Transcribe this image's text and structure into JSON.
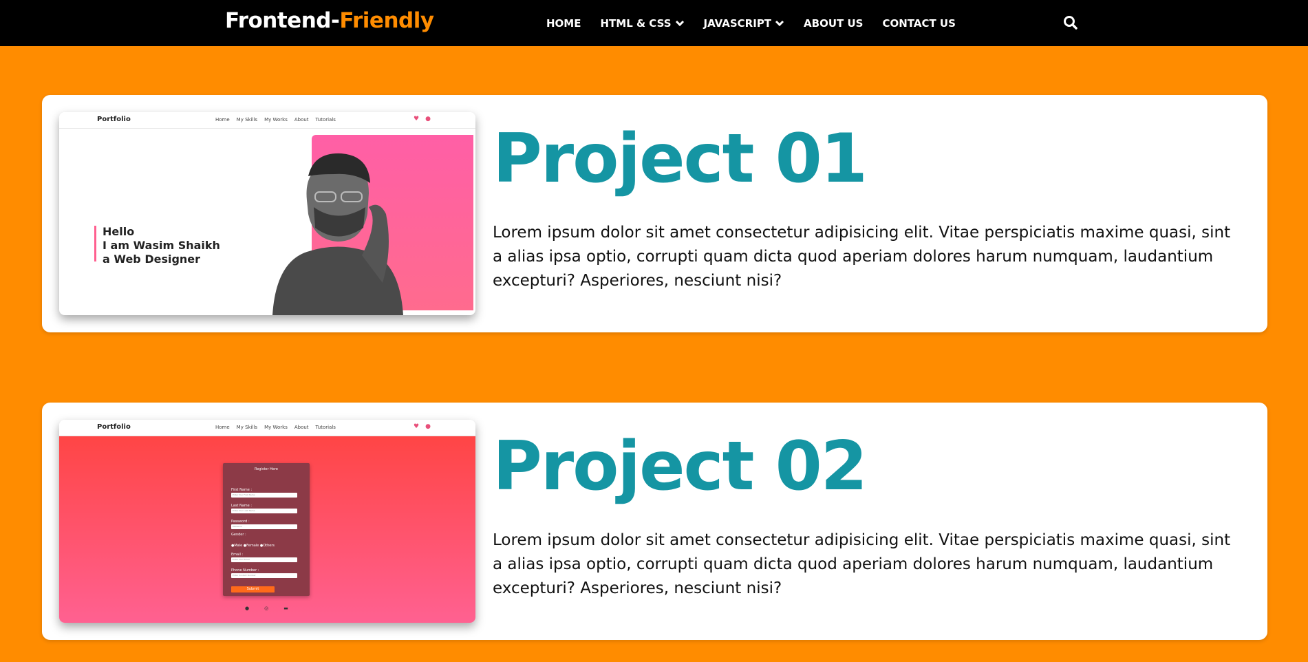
{
  "nav": {
    "brand_main": "Frontend-",
    "brand_accent": "Friendly",
    "items": [
      {
        "label": "HOME",
        "dropdown": false
      },
      {
        "label": "HTML & CSS",
        "dropdown": true
      },
      {
        "label": "JAVASCRIPT",
        "dropdown": true
      },
      {
        "label": "ABOUT US",
        "dropdown": false
      },
      {
        "label": "CONTACT US",
        "dropdown": false
      }
    ],
    "search_icon": "search-icon"
  },
  "colors": {
    "page_bg": "#ff8c00",
    "nav_bg": "#000000",
    "brand_accent": "#ff8c00",
    "title": "#1595a3"
  },
  "projects": [
    {
      "title": "Project 01",
      "description": "Lorem ipsum dolor sit amet consectetur adipisicing elit. Vitae perspiciatis maxime quasi, sint a alias ipsa optio, corrupti quam dicta quod aperiam dolores harum numquam, laudantium excepturi? Asperiores, nesciunt nisi?",
      "preview": {
        "brand": "Portfolio",
        "links": [
          "Home",
          "My Skills",
          "My Works",
          "About",
          "Tutorials"
        ],
        "hello_lines": [
          "Hello",
          "I am Wasim Shaikh",
          "a Web Designer"
        ]
      }
    },
    {
      "title": "Project 02",
      "description": "Lorem ipsum dolor sit amet consectetur adipisicing elit. Vitae perspiciatis maxime quasi, sint a alias ipsa optio, corrupti quam dicta quod aperiam dolores harum numquam, laudantium excepturi? Asperiores, nesciunt nisi?",
      "preview": {
        "brand": "Portfolio",
        "links": [
          "Home",
          "My Skills",
          "My Works",
          "About",
          "Tutorials"
        ],
        "form": {
          "title": "Register Here",
          "fields": [
            {
              "label": "First Name :",
              "placeholder": "Enter Your First Name"
            },
            {
              "label": "Last Name :",
              "placeholder": "Enter Your Last Name"
            },
            {
              "label": "Password :",
              "placeholder": "Password"
            },
            {
              "label": "Email :",
              "placeholder": "Enter Your Email"
            },
            {
              "label": "Phone Number :",
              "placeholder": "Enter Contact Number"
            }
          ],
          "gender_label": "Gender :",
          "gender_options": "●Male  ●Female  ●Others",
          "submit": "Submit"
        }
      }
    }
  ]
}
